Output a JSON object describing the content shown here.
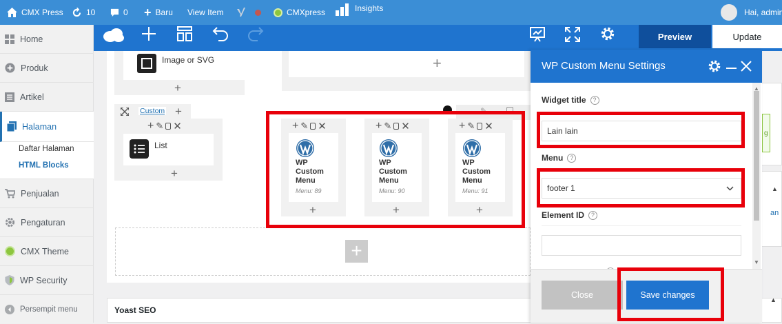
{
  "adminbar": {
    "site_name": "CMX Press",
    "updates_count": "10",
    "comments_count": "0",
    "new_label": "Baru",
    "view_item_label": "View Item",
    "cmxpress_label": "CMXpress",
    "insights_label": "Insights",
    "greeting": "Hai, admin",
    "color": "#3b8ed6"
  },
  "sidebar": {
    "items": [
      {
        "label": "Home",
        "icon": "dashboard-icon"
      },
      {
        "label": "Produk",
        "icon": "plus-circle-icon"
      },
      {
        "label": "Artikel",
        "icon": "posts-icon"
      },
      {
        "label": "Halaman",
        "icon": "pages-icon"
      },
      {
        "label": "Penjualan",
        "icon": "cart-icon"
      },
      {
        "label": "Pengaturan",
        "icon": "gear-icon"
      },
      {
        "label": "CMX Theme",
        "icon": "theme-icon"
      },
      {
        "label": "WP Security",
        "icon": "shield-icon"
      },
      {
        "label": "Persempit menu",
        "icon": "collapse-icon"
      }
    ],
    "submenu": [
      "Daftar Halaman",
      "HTML Blocks"
    ]
  },
  "toolbar": {
    "preview_label": "Preview",
    "update_label": "Update",
    "color": "#1f74cf"
  },
  "canvas": {
    "image_widget_label": "Image or SVG",
    "custom_tab_label": "Custom",
    "list_widget_label": "List",
    "wp_widgets": [
      {
        "name": "WP Custom Menu",
        "sub": "Menu: 89"
      },
      {
        "name": "WP Custom Menu",
        "sub": "Menu: 90"
      },
      {
        "name": "WP Custom Menu",
        "sub": "Menu: 91"
      }
    ]
  },
  "panel": {
    "title": "WP Custom Menu Settings",
    "widget_title_label": "Widget title",
    "widget_title_value": "Lain lain",
    "menu_label": "Menu",
    "menu_value": "footer 1",
    "element_id_label": "Element ID",
    "element_id_value": "",
    "close_label": "Close",
    "save_label": "Save changes"
  },
  "background": {
    "yoast_label": "Yoast SEO",
    "right_link_fragment": "an"
  },
  "highlight_color": "#e8000a"
}
